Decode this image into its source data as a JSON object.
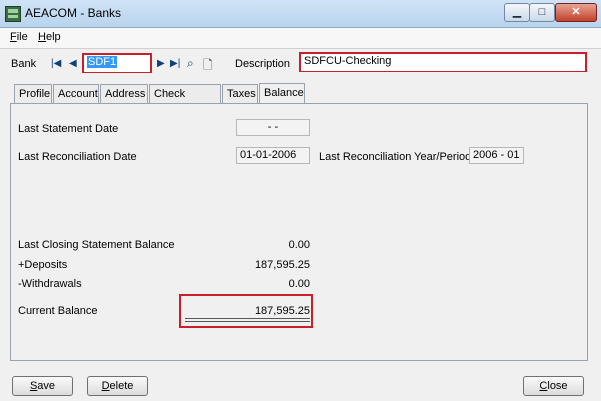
{
  "window": {
    "title": "AEACOM - Banks"
  },
  "menu": {
    "file_first": "F",
    "file_rest": "ile",
    "help_first": "H",
    "help_rest": "elp"
  },
  "bank": {
    "label": "Bank",
    "value": "SDF1",
    "description_label": "Description",
    "description_value": "SDFCU-Checking"
  },
  "tabs": [
    {
      "label": "Profile"
    },
    {
      "label": "Account"
    },
    {
      "label": "Address"
    },
    {
      "label": "Check Stocks"
    },
    {
      "label": "Taxes"
    },
    {
      "label": "Balance"
    }
  ],
  "balance": {
    "last_statement_date_label": "Last Statement Date",
    "last_statement_date_value": "- -",
    "last_reconciliation_date_label": "Last Reconciliation Date",
    "last_reconciliation_date_value": "01-01-2006",
    "last_reconciliation_period_label": "Last Reconciliation Year/Period",
    "last_reconciliation_period_value": "2006 - 01",
    "last_closing_label": "Last Closing Statement Balance",
    "last_closing_value": "0.00",
    "deposits_label": "+Deposits",
    "deposits_value": "187,595.25",
    "withdrawals_label": "-Withdrawals",
    "withdrawals_value": "0.00",
    "current_label": "Current Balance",
    "current_value": "187,595.25"
  },
  "buttons": {
    "save_first": "S",
    "save_rest": "ave",
    "delete_first": "D",
    "delete_rest": "elete",
    "close_first": "C",
    "close_rest": "lose"
  },
  "colors": {
    "highlight": "#c8202a",
    "selection": "#3399ff"
  }
}
